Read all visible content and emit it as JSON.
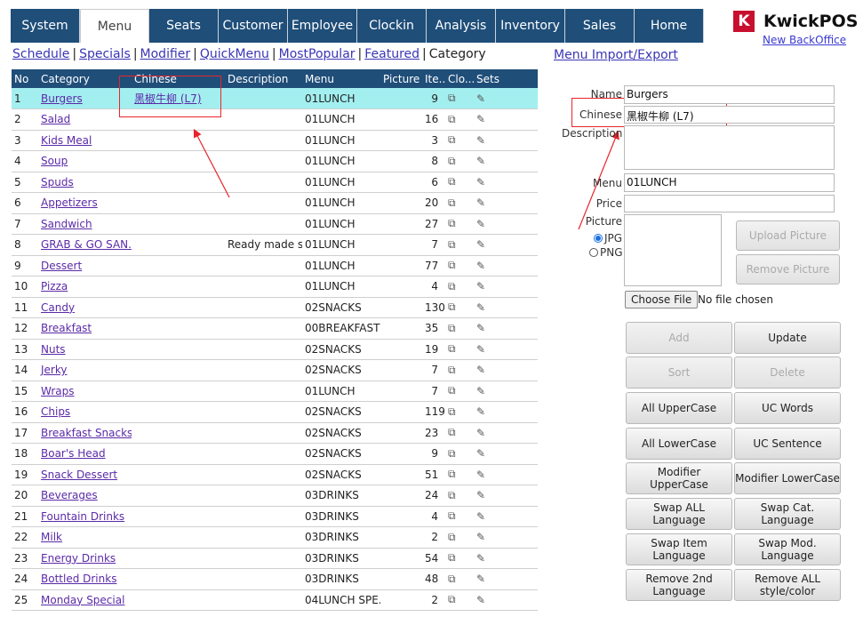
{
  "tabs": [
    {
      "label": "System",
      "active": false
    },
    {
      "label": "Menu",
      "active": true
    },
    {
      "label": "Seats",
      "active": false
    },
    {
      "label": "Customer",
      "active": false
    },
    {
      "label": "Employee",
      "active": false
    },
    {
      "label": "Clockin",
      "active": false
    },
    {
      "label": "Analysis",
      "active": false
    },
    {
      "label": "Inventory",
      "active": false
    },
    {
      "label": "Sales",
      "active": false
    },
    {
      "label": "Home",
      "active": false
    }
  ],
  "brand": {
    "name": "KwickPOS",
    "logo_letter": "K",
    "new_backoffice": "New BackOffice",
    "logo_color": "#c8102e"
  },
  "subnav": {
    "links": [
      "Schedule",
      "Specials",
      "Modifier",
      "QuickMenu",
      "MostPopular",
      "Featured"
    ],
    "current": "Category",
    "import_export": "Menu Import/Export"
  },
  "table": {
    "headers": [
      "No",
      "Category",
      "Chinese",
      "Description",
      "Menu",
      "Picture",
      "Ite...",
      "Clo...",
      "Sets"
    ],
    "rows": [
      {
        "no": "1",
        "category": "Burgers",
        "chinese": "黑椒牛柳 (L7)",
        "description": "",
        "menu": "01LUNCH",
        "items": "9"
      },
      {
        "no": "2",
        "category": "Salad",
        "chinese": "",
        "description": "",
        "menu": "01LUNCH",
        "items": "16"
      },
      {
        "no": "3",
        "category": "Kids Meal",
        "chinese": "",
        "description": "",
        "menu": "01LUNCH",
        "items": "3"
      },
      {
        "no": "4",
        "category": "Soup",
        "chinese": "",
        "description": "",
        "menu": "01LUNCH",
        "items": "8"
      },
      {
        "no": "5",
        "category": "Spuds",
        "chinese": "",
        "description": "",
        "menu": "01LUNCH",
        "items": "6"
      },
      {
        "no": "6",
        "category": "Appetizers",
        "chinese": "",
        "description": "",
        "menu": "01LUNCH",
        "items": "20"
      },
      {
        "no": "7",
        "category": "Sandwich",
        "chinese": "",
        "description": "",
        "menu": "01LUNCH",
        "items": "27"
      },
      {
        "no": "8",
        "category": "GRAB & GO SAN...",
        "chinese": "",
        "description": "Ready made s...",
        "menu": "01LUNCH",
        "items": "7"
      },
      {
        "no": "9",
        "category": "Dessert",
        "chinese": "",
        "description": "",
        "menu": "01LUNCH",
        "items": "77"
      },
      {
        "no": "10",
        "category": "Pizza",
        "chinese": "",
        "description": "",
        "menu": "01LUNCH",
        "items": "4"
      },
      {
        "no": "11",
        "category": "Candy",
        "chinese": "",
        "description": "",
        "menu": "02SNACKS",
        "items": "130"
      },
      {
        "no": "12",
        "category": "Breakfast",
        "chinese": "",
        "description": "",
        "menu": "00BREAKFAST",
        "items": "35"
      },
      {
        "no": "13",
        "category": "Nuts",
        "chinese": "",
        "description": "",
        "menu": "02SNACKS",
        "items": "19"
      },
      {
        "no": "14",
        "category": "Jerky",
        "chinese": "",
        "description": "",
        "menu": "02SNACKS",
        "items": "7"
      },
      {
        "no": "15",
        "category": "Wraps",
        "chinese": "",
        "description": "",
        "menu": "01LUNCH",
        "items": "7"
      },
      {
        "no": "16",
        "category": "Chips",
        "chinese": "",
        "description": "",
        "menu": "02SNACKS",
        "items": "119"
      },
      {
        "no": "17",
        "category": "Breakfast Snacks",
        "chinese": "",
        "description": "",
        "menu": "02SNACKS",
        "items": "23"
      },
      {
        "no": "18",
        "category": "Boar's Head",
        "chinese": "",
        "description": "",
        "menu": "02SNACKS",
        "items": "9"
      },
      {
        "no": "19",
        "category": "Snack Dessert",
        "chinese": "",
        "description": "",
        "menu": "02SNACKS",
        "items": "51"
      },
      {
        "no": "20",
        "category": "Beverages",
        "chinese": "",
        "description": "",
        "menu": "03DRINKS",
        "items": "24"
      },
      {
        "no": "21",
        "category": "Fountain Drinks",
        "chinese": "",
        "description": "",
        "menu": "03DRINKS",
        "items": "4"
      },
      {
        "no": "22",
        "category": "Milk",
        "chinese": "",
        "description": "",
        "menu": "03DRINKS",
        "items": "2"
      },
      {
        "no": "23",
        "category": "Energy Drinks",
        "chinese": "",
        "description": "",
        "menu": "03DRINKS",
        "items": "54"
      },
      {
        "no": "24",
        "category": "Bottled Drinks",
        "chinese": "",
        "description": "",
        "menu": "03DRINKS",
        "items": "48"
      },
      {
        "no": "25",
        "category": "Monday Special",
        "chinese": "",
        "description": "",
        "menu": "04LUNCH SPE...",
        "items": "2"
      }
    ]
  },
  "form": {
    "name_label": "Name",
    "name_value": "Burgers",
    "chinese_label": "Chinese",
    "chinese_value": "黑椒牛柳 (L7)",
    "description_label": "Description",
    "description_value": "",
    "menu_label": "Menu",
    "menu_value": "01LUNCH",
    "price_label": "Price",
    "price_value": "",
    "picture_label": "Picture",
    "jpg_label": "JPG",
    "png_label": "PNG",
    "selected_format": "JPG",
    "upload_picture": "Upload Picture",
    "remove_picture": "Remove Picture",
    "choose_file": "Choose File",
    "no_file": "No file chosen"
  },
  "buttons": {
    "add": "Add",
    "update": "Update",
    "sort": "Sort",
    "delete": "Delete",
    "all_upper": "All UpperCase",
    "uc_words": "UC Words",
    "all_lower": "All LowerCase",
    "uc_sentence": "UC Sentence",
    "mod_upper": "Modifier UpperCase",
    "mod_lower": "Modifier LowerCase",
    "swap_all": "Swap ALL Language",
    "swap_cat": "Swap Cat. Language",
    "swap_item": "Swap Item Language",
    "swap_mod": "Swap Mod. Language",
    "remove_2nd": "Remove 2nd Language",
    "remove_all_style": "Remove ALL style/color"
  },
  "colors": {
    "tab_bg": "#1f4e79",
    "selected_row": "#a3eff0",
    "highlight": "#e8252a",
    "link": "#3a35b4"
  }
}
